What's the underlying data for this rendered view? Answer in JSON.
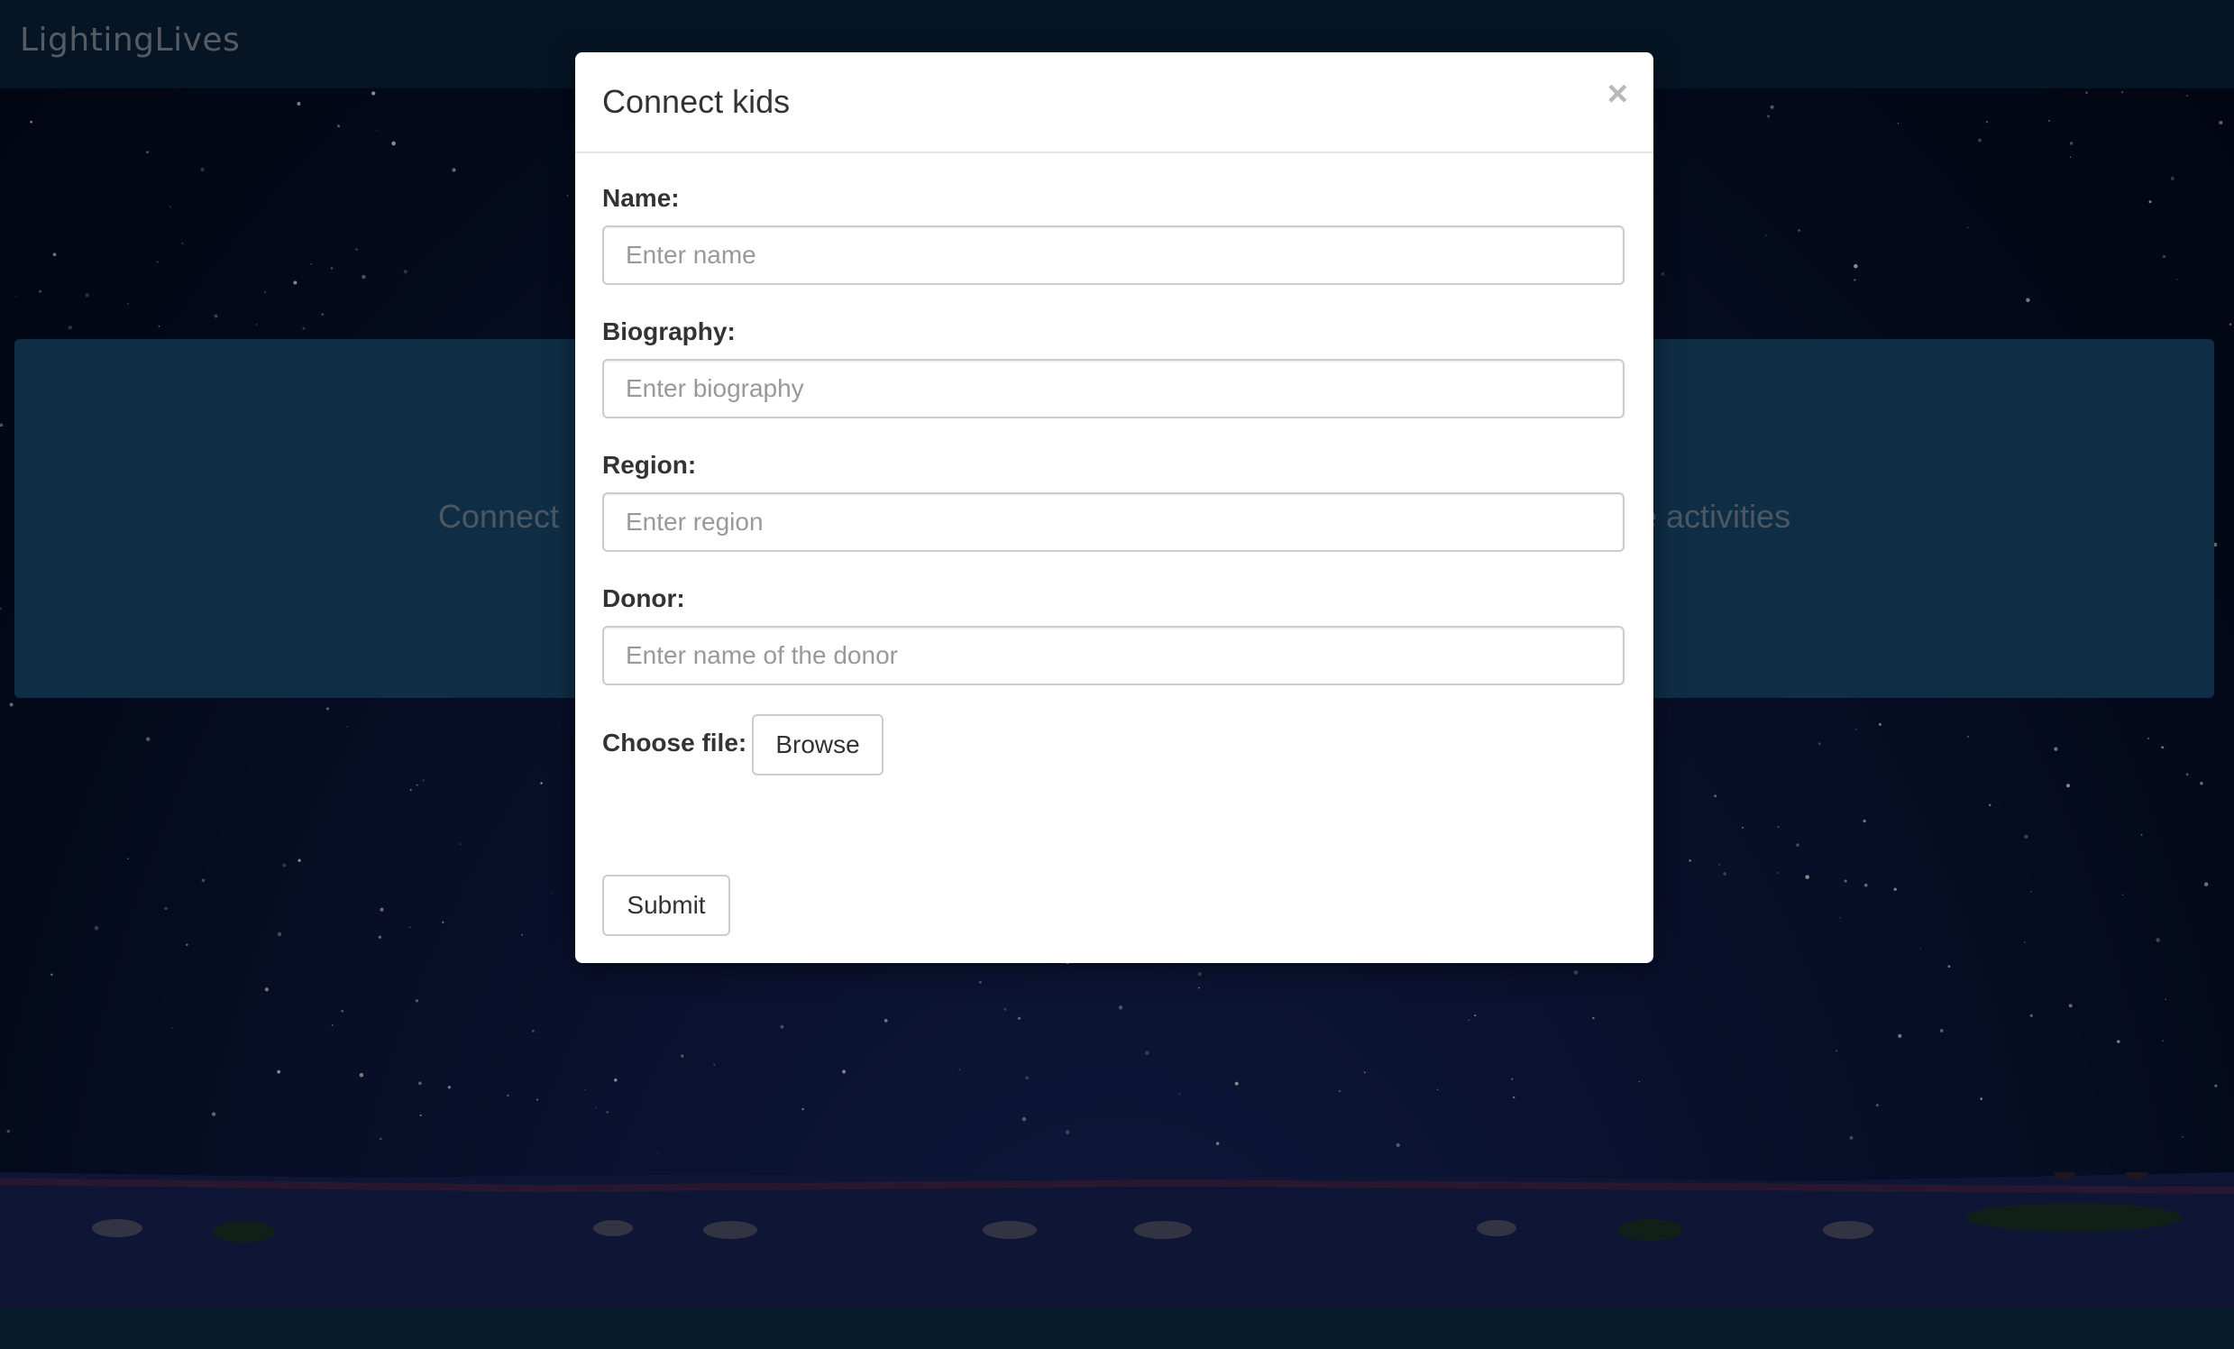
{
  "navbar": {
    "brand": "LightingLives"
  },
  "hero": {
    "text_left": "Connect",
    "text_right": "e activities"
  },
  "modal": {
    "title": "Connect kids",
    "close_symbol": "×",
    "fields": {
      "name": {
        "label": "Name:",
        "placeholder": "Enter name",
        "value": ""
      },
      "biography": {
        "label": "Biography:",
        "placeholder": "Enter biography",
        "value": ""
      },
      "region": {
        "label": "Region:",
        "placeholder": "Enter region",
        "value": ""
      },
      "donor": {
        "label": "Donor:",
        "placeholder": "Enter name of the donor",
        "value": ""
      }
    },
    "file": {
      "label": "Choose file:",
      "browse_label": "Browse"
    },
    "submit_label": "Submit"
  },
  "icons": {
    "close": "close-icon"
  },
  "colors": {
    "navbar_bg": "#0b2744",
    "hero_bg": "#1c5480",
    "modal_bg": "#ffffff",
    "input_border": "#cccccc"
  }
}
